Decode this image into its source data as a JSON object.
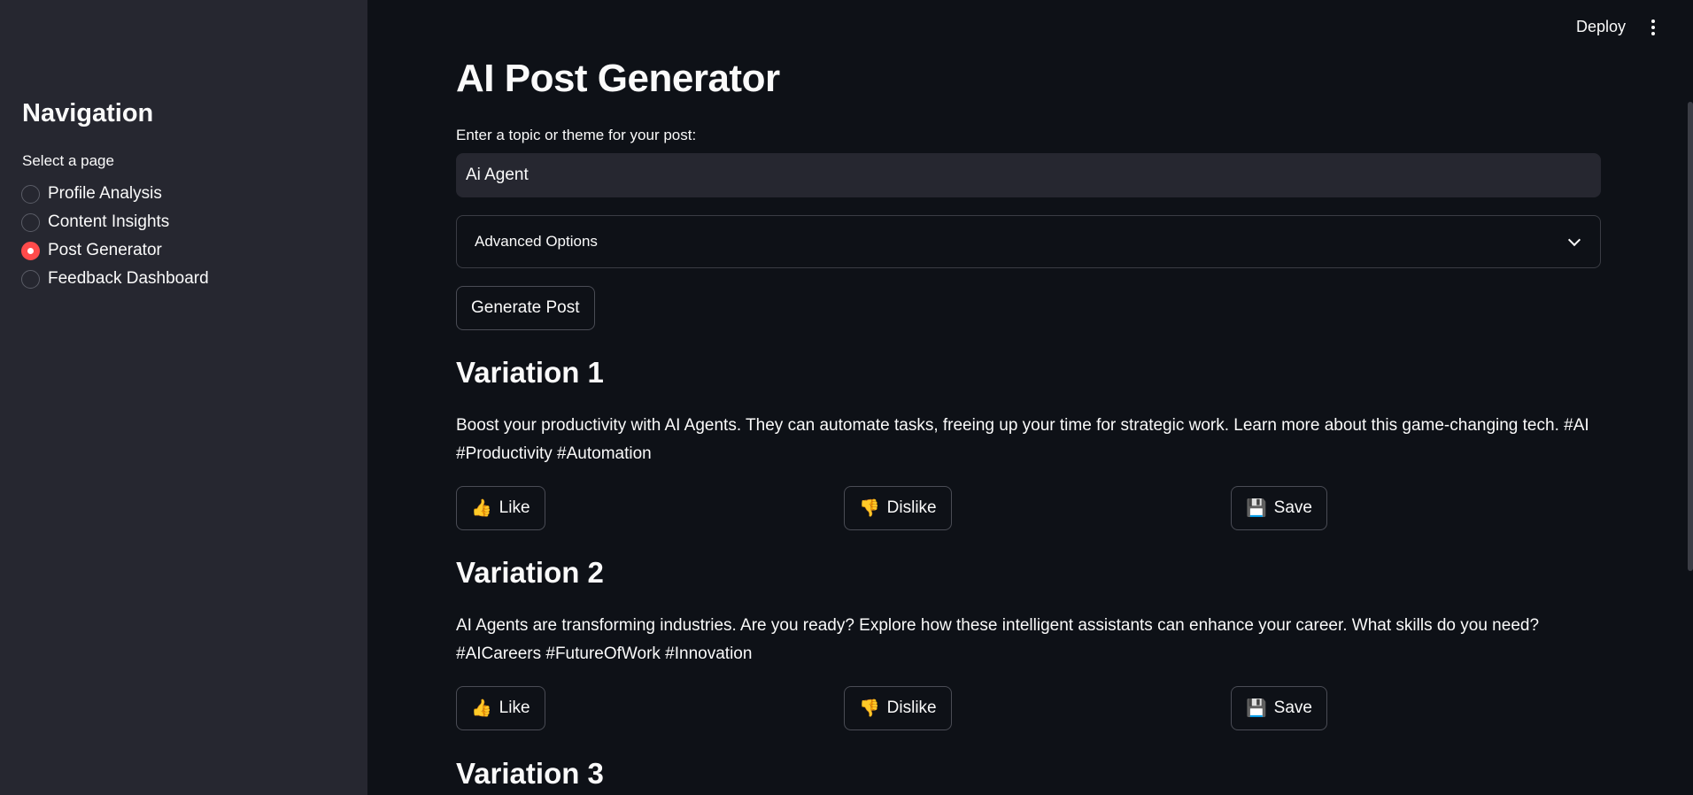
{
  "sidebar": {
    "title": "Navigation",
    "select_label": "Select a page",
    "pages": [
      {
        "label": "Profile Analysis",
        "selected": false
      },
      {
        "label": "Content Insights",
        "selected": false
      },
      {
        "label": "Post Generator",
        "selected": true
      },
      {
        "label": "Feedback Dashboard",
        "selected": false
      }
    ]
  },
  "topbar": {
    "deploy_label": "Deploy",
    "menu_icon": "vertical-ellipsis-icon"
  },
  "main": {
    "title": "AI Post Generator",
    "topic_label": "Enter a topic or theme for your post:",
    "topic_value": "Ai Agent",
    "advanced_options_label": "Advanced Options",
    "generate_button_label": "Generate Post",
    "variations": [
      {
        "heading": "Variation 1",
        "text": "Boost your productivity with AI Agents. They can automate tasks, freeing up your time for strategic work. Learn more about this game-changing tech. #AI #Productivity #Automation",
        "like_label": "Like",
        "dislike_label": "Dislike",
        "save_label": "Save"
      },
      {
        "heading": "Variation 2",
        "text": "AI Agents are transforming industries. Are you ready? Explore how these intelligent assistants can enhance your career. What skills do you need? #AICareers #FutureOfWork #Innovation",
        "like_label": "Like",
        "dislike_label": "Dislike",
        "save_label": "Save"
      },
      {
        "heading": "Variation 3"
      }
    ]
  },
  "icons": {
    "like": "👍",
    "dislike": "👎",
    "save": "💾"
  },
  "colors": {
    "accent": "#ff4b4b",
    "background": "#0e1117",
    "sidebar_background": "#262730"
  }
}
